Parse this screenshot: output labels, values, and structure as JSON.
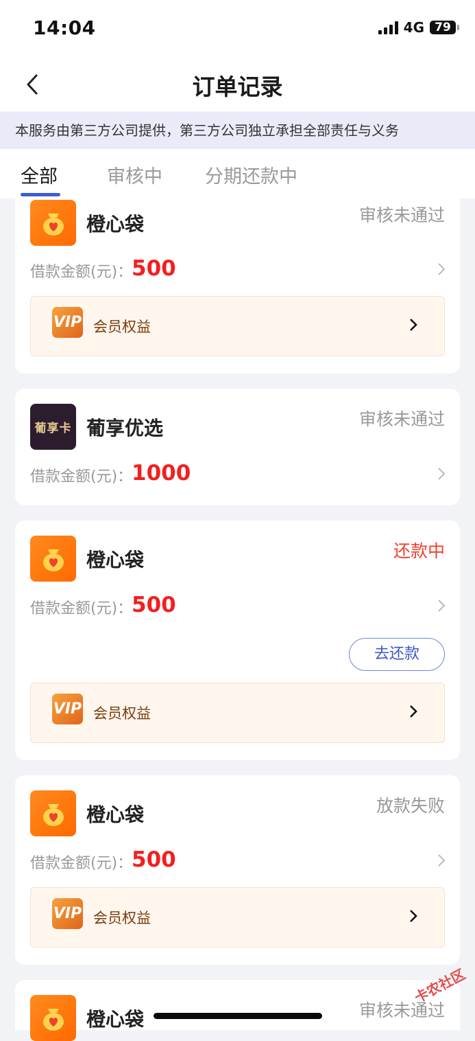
{
  "status_bar": {
    "time": "14:04",
    "network": "4G",
    "battery": "79"
  },
  "nav": {
    "title": "订单记录"
  },
  "notice": "本服务由第三方公司提供，第三方公司独立承担全部责任与义务",
  "tabs": [
    {
      "label": "全部",
      "active": true
    },
    {
      "label": "审核中",
      "active": false
    },
    {
      "label": "分期还款中",
      "active": false
    }
  ],
  "amount_label": "借款金额(元)：",
  "vip_label": "会员权益",
  "repay_label": "去还款",
  "orders": [
    {
      "name": "橙心袋",
      "status": "审核未通过",
      "amount": "500",
      "logo": "money-bag-heart-icon"
    },
    {
      "name": "葡享优选",
      "status": "审核未通过",
      "amount": "1000",
      "logo": "葡享卡"
    },
    {
      "name": "橙心袋",
      "status": "还款中",
      "amount": "500",
      "logo": "money-bag-heart-icon"
    },
    {
      "name": "橙心袋",
      "status": "放款失败",
      "amount": "500",
      "logo": "money-bag-heart-icon"
    },
    {
      "name": "橙心袋",
      "status": "审核未通过",
      "logo": "money-bag-heart-icon"
    }
  ],
  "watermark": "卡农社区",
  "colors": {
    "accent": "#3d5bd9",
    "amount": "#f31f1f",
    "status_red": "#f0412d",
    "brand_orange": "#ff6a00"
  }
}
